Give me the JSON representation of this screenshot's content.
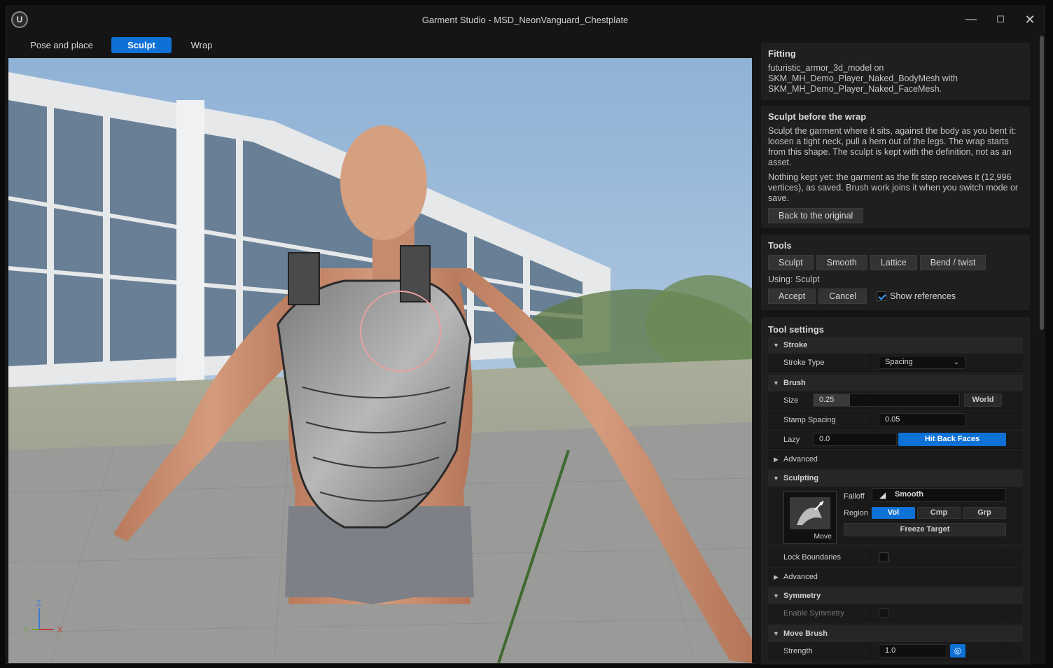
{
  "window": {
    "title": "Garment Studio - MSD_NeonVanguard_Chestplate",
    "logo": "U",
    "controls": {
      "minimize": "—",
      "maximize": "☐",
      "close": "✕"
    }
  },
  "modes": {
    "tabs": [
      {
        "label": "Pose and place"
      },
      {
        "label": "Sculpt",
        "active": true
      },
      {
        "label": "Wrap"
      }
    ]
  },
  "viewport": {
    "axis": {
      "z": "Z",
      "y": "Y",
      "x": "X"
    }
  },
  "fitting": {
    "heading": "Fitting",
    "body": "futuristic_armor_3d_model on SKM_MH_Demo_Player_Naked_BodyMesh with SKM_MH_Demo_Player_Naked_FaceMesh."
  },
  "sculpt_info": {
    "heading": "Sculpt before the wrap",
    "para1": "Sculpt the garment where it sits, against the body as you bent it: loosen a tight neck, pull a hem out of the legs. The wrap starts from this shape. The sculpt is kept with the definition, not as an asset.",
    "para2": "Nothing kept yet: the garment as the fit step receives it (12,996 vertices), as saved. Brush work joins it when you switch mode or save.",
    "back_button": "Back to the original"
  },
  "tools": {
    "heading": "Tools",
    "buttons": [
      "Sculpt",
      "Smooth",
      "Lattice",
      "Bend / twist"
    ],
    "using": "Using: Sculpt",
    "accept": "Accept",
    "cancel": "Cancel",
    "show_references": "Show references",
    "show_references_checked": true
  },
  "tool_settings": {
    "heading": "Tool settings",
    "stroke": {
      "section": "Stroke",
      "stroke_type_label": "Stroke Type",
      "stroke_type_value": "Spacing"
    },
    "brush": {
      "section": "Brush",
      "size_label": "Size",
      "size_value": "0.25",
      "size_fraction": 0.25,
      "size_space": "World",
      "stamp_spacing_label": "Stamp Spacing",
      "stamp_spacing_value": "0.05",
      "lazy_label": "Lazy",
      "lazy_value": "0.0",
      "hit_back_faces": "Hit Back Faces",
      "advanced": "Advanced"
    },
    "sculpting": {
      "section": "Sculpting",
      "brush_name": "Move",
      "falloff_label": "Falloff",
      "falloff_value": "Smooth",
      "region_label": "Region",
      "region_options": [
        "Vol",
        "Cmp",
        "Grp"
      ],
      "region_selected": "Vol",
      "freeze_target": "Freeze Target",
      "lock_boundaries": "Lock Boundaries",
      "advanced": "Advanced"
    },
    "symmetry": {
      "section": "Symmetry",
      "enable_label": "Enable Symmetry"
    },
    "move_brush": {
      "section": "Move Brush",
      "strength_label": "Strength",
      "strength_value": "1.0"
    }
  },
  "colors": {
    "accent": "#0e71d6",
    "panel_bg": "#1f1f1f",
    "window_bg": "#151515",
    "brush_ring": "#e8a0a0"
  }
}
